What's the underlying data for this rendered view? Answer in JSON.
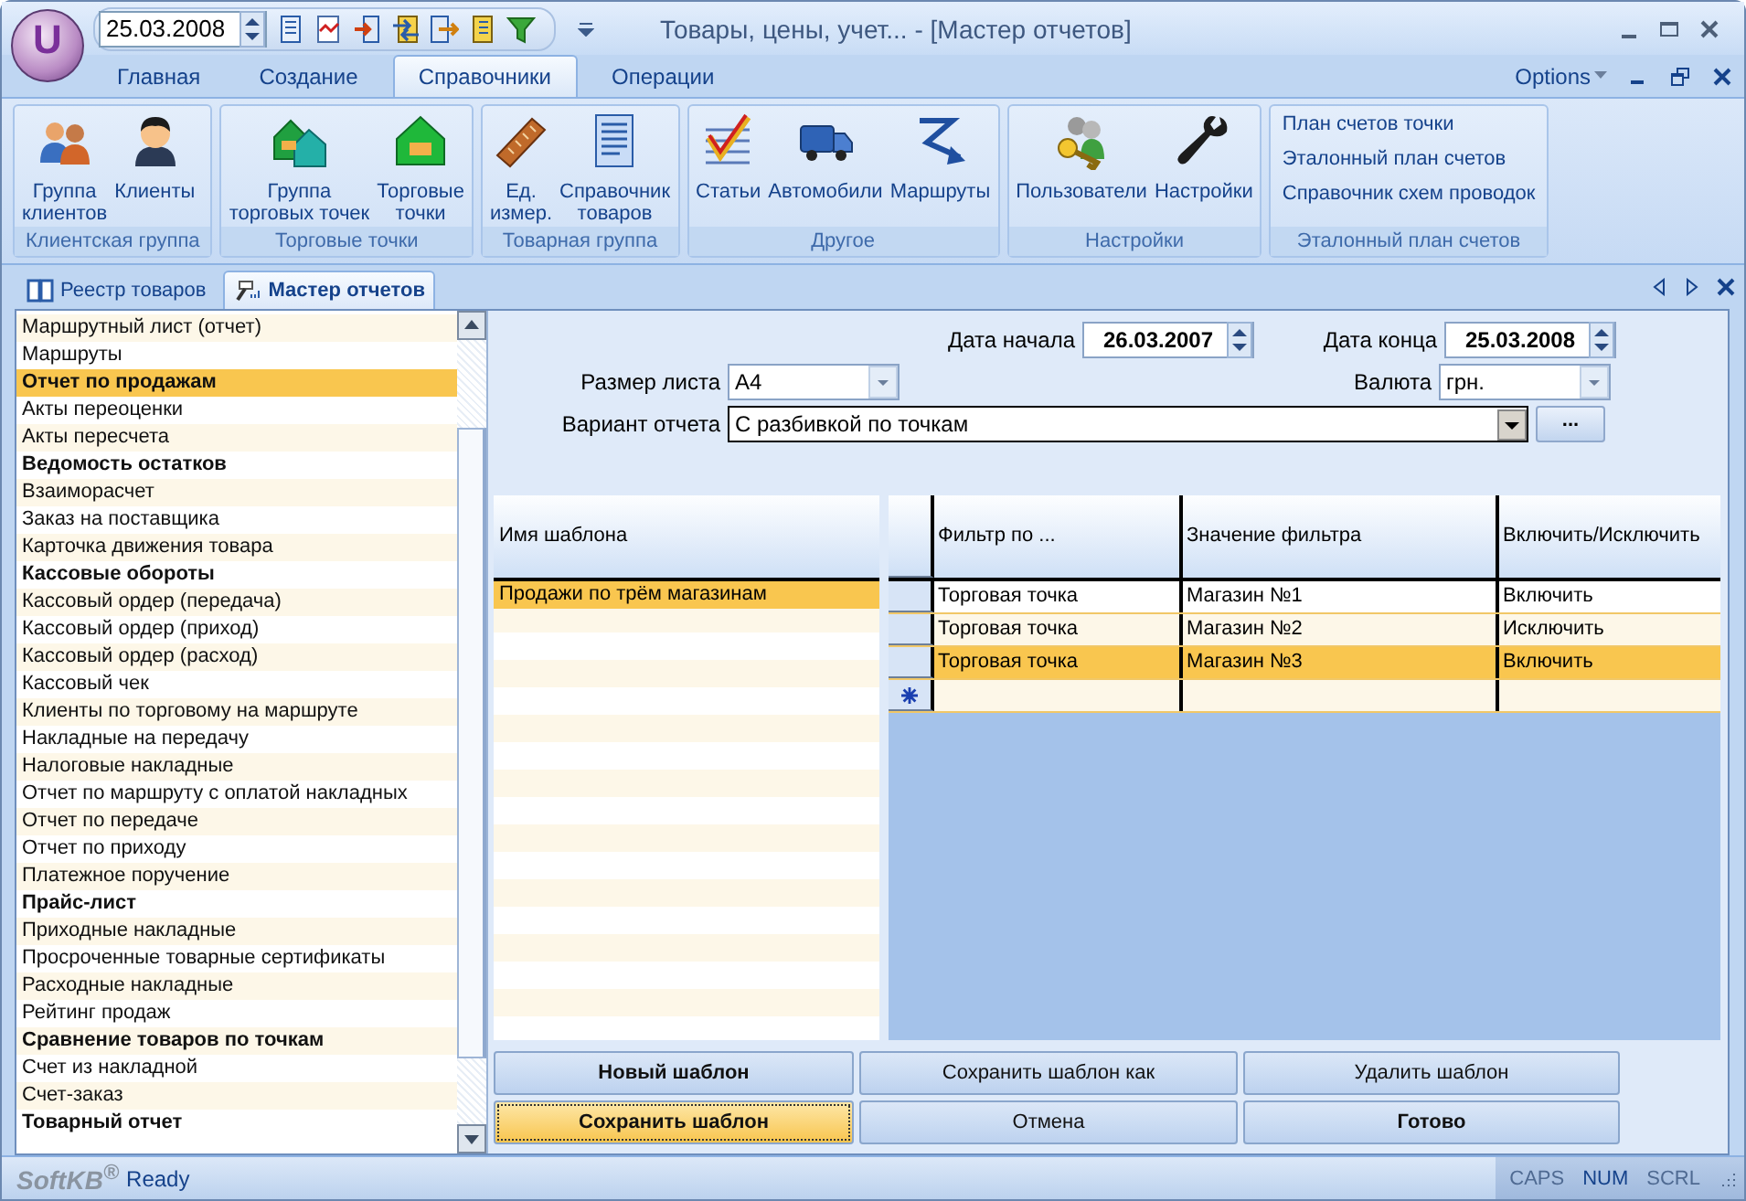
{
  "app_logo": "U",
  "quick_access": {
    "date": "25.03.2008"
  },
  "window": {
    "title": "Товары, цены, учет... - [Мастер отчетов]"
  },
  "ribbon_tabs": [
    {
      "label": "Главная",
      "selected": false
    },
    {
      "label": "Создание",
      "selected": false
    },
    {
      "label": "Справочники",
      "selected": true
    },
    {
      "label": "Операции",
      "selected": false
    }
  ],
  "options_menu": "Options",
  "ribbon_groups": [
    {
      "label": "Клиентская группа",
      "kind": "large",
      "items": [
        "Группа\nклиентов",
        "Клиенты"
      ]
    },
    {
      "label": "Торговые точки",
      "kind": "large",
      "items": [
        "Группа\nторговых точек",
        "Торговые\nточки"
      ]
    },
    {
      "label": "Товарная группа",
      "kind": "large",
      "items": [
        "Ед.\nизмер.",
        "Справочник\nтоваров"
      ]
    },
    {
      "label": "Другое",
      "kind": "large",
      "items": [
        "Статьи",
        "Автомобили",
        "Маршруты"
      ]
    },
    {
      "label": "Настройки",
      "kind": "large",
      "items": [
        "Пользователи",
        "Настройки"
      ]
    },
    {
      "label": "Эталонный план счетов",
      "kind": "links",
      "items": [
        "План счетов точки",
        "Эталонный план счетов",
        "Справочник схем проводок"
      ]
    }
  ],
  "document_tabs": [
    {
      "label": "Реестр товаров",
      "selected": false
    },
    {
      "label": "Мастер отчетов",
      "selected": true
    }
  ],
  "reports": [
    {
      "label": "Маршрутный лист (отчет)",
      "bold": false,
      "selected": false
    },
    {
      "label": "Маршруты",
      "bold": false,
      "selected": false
    },
    {
      "label": "Отчет по продажам",
      "bold": true,
      "selected": true
    },
    {
      "label": "Акты переоценки",
      "bold": false,
      "selected": false
    },
    {
      "label": "Акты пересчета",
      "bold": false,
      "selected": false
    },
    {
      "label": "Ведомость остатков",
      "bold": true,
      "selected": false
    },
    {
      "label": "Взаиморасчет",
      "bold": false,
      "selected": false
    },
    {
      "label": "Заказ на поставщика",
      "bold": false,
      "selected": false
    },
    {
      "label": "Карточка движения товара",
      "bold": false,
      "selected": false
    },
    {
      "label": "Кассовые обороты",
      "bold": true,
      "selected": false
    },
    {
      "label": "Кассовый ордер (передача)",
      "bold": false,
      "selected": false
    },
    {
      "label": "Кассовый ордер (приход)",
      "bold": false,
      "selected": false
    },
    {
      "label": "Кассовый ордер (расход)",
      "bold": false,
      "selected": false
    },
    {
      "label": "Кассовый чек",
      "bold": false,
      "selected": false
    },
    {
      "label": "Клиенты по торговому на маршруте",
      "bold": false,
      "selected": false
    },
    {
      "label": "Накладные на передачу",
      "bold": false,
      "selected": false
    },
    {
      "label": "Налоговые накладные",
      "bold": false,
      "selected": false
    },
    {
      "label": "Отчет по маршруту с оплатой накладных",
      "bold": false,
      "selected": false
    },
    {
      "label": "Отчет по передаче",
      "bold": false,
      "selected": false
    },
    {
      "label": "Отчет по приходу",
      "bold": false,
      "selected": false
    },
    {
      "label": "Платежное поручение",
      "bold": false,
      "selected": false
    },
    {
      "label": "Прайс-лист",
      "bold": true,
      "selected": false
    },
    {
      "label": "Приходные накладные",
      "bold": false,
      "selected": false
    },
    {
      "label": "Просроченные товарные сертификаты",
      "bold": false,
      "selected": false
    },
    {
      "label": "Расходные накладные",
      "bold": false,
      "selected": false
    },
    {
      "label": "Рейтинг продаж",
      "bold": false,
      "selected": false
    },
    {
      "label": "Сравнение товаров по точкам",
      "bold": true,
      "selected": false
    },
    {
      "label": "Счет из накладной",
      "bold": false,
      "selected": false
    },
    {
      "label": "Счет-заказ",
      "bold": false,
      "selected": false
    },
    {
      "label": "Товарный отчет",
      "bold": true,
      "selected": false
    }
  ],
  "form": {
    "start_label": "Дата начала",
    "start_date": "26.03.2007",
    "end_label": "Дата конца",
    "end_date": "25.03.2008",
    "page_size_label": "Размер листа",
    "page_size": "A4",
    "currency_label": "Валюта",
    "currency": "грн.",
    "variant_label": "Вариант отчета",
    "variant": "С разбивкой по точкам",
    "browse_button": "..."
  },
  "templates": {
    "column": "Имя шаблона",
    "rows": [
      {
        "name": "Продажи по трём магазинам",
        "selected": true
      }
    ]
  },
  "filters": {
    "columns": [
      "Фильтр по ...",
      "Значение фильтра",
      "Включить/Исключить"
    ],
    "rows": [
      {
        "cells": [
          "Торговая точка",
          "Магазин №1",
          "Включить"
        ],
        "selected": false
      },
      {
        "cells": [
          "Торговая точка",
          "Магазин №2",
          "Исключить"
        ],
        "selected": false
      },
      {
        "cells": [
          "Торговая точка",
          "Магазин №3",
          "Включить"
        ],
        "selected": true
      }
    ]
  },
  "buttons": [
    {
      "label": "Новый шаблон",
      "bold": true,
      "focused": false
    },
    {
      "label": "Сохранить шаблон как",
      "bold": false,
      "focused": false
    },
    {
      "label": "Удалить шаблон",
      "bold": false,
      "focused": false
    },
    {
      "label": "Сохранить шаблон",
      "bold": true,
      "focused": true
    },
    {
      "label": "Отмена",
      "bold": false,
      "focused": false
    },
    {
      "label": "Готово",
      "bold": true,
      "focused": false
    }
  ],
  "status_bar": {
    "logo": "SoftKB$^{®}$",
    "text": "Ready",
    "indicators": [
      {
        "label": "CAPS",
        "on": false
      },
      {
        "label": "NUM",
        "on": true
      },
      {
        "label": "SCRL",
        "on": false
      }
    ]
  }
}
